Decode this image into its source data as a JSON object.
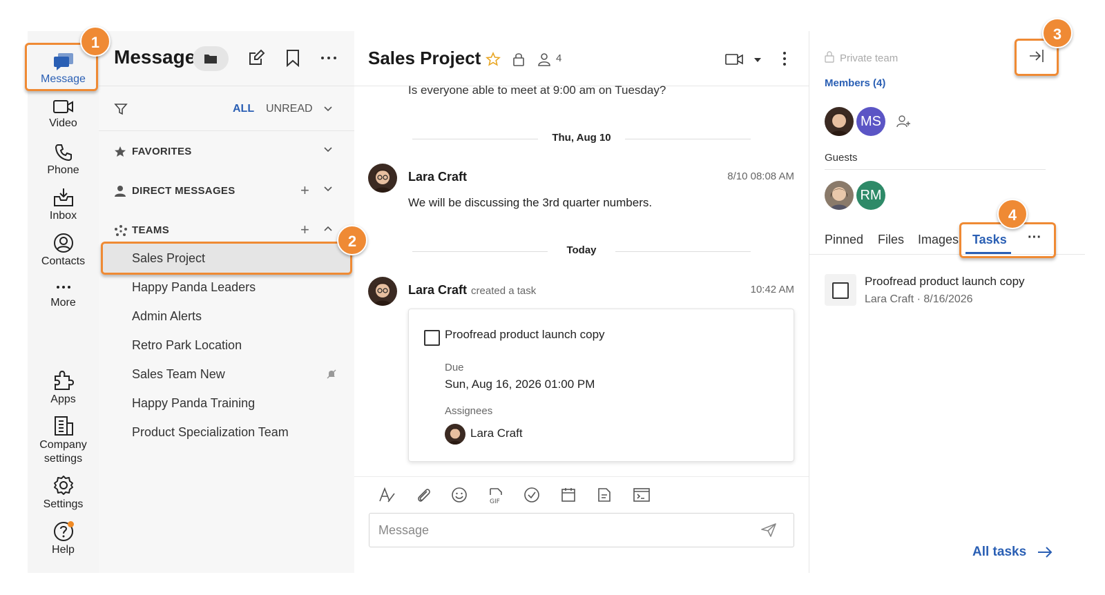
{
  "rail": {
    "items": [
      {
        "label": "Message"
      },
      {
        "label": "Video"
      },
      {
        "label": "Phone"
      },
      {
        "label": "Inbox"
      },
      {
        "label": "Contacts"
      },
      {
        "label": "More"
      },
      {
        "label": "Apps"
      },
      {
        "label": "Company settings"
      },
      {
        "label": "Settings"
      },
      {
        "label": "Help"
      }
    ]
  },
  "list": {
    "title": "Message",
    "filter_all": "ALL",
    "filter_unread": "UNREAD",
    "favorites": "FAVORITES",
    "direct_messages": "DIRECT MESSAGES",
    "teams": "TEAMS",
    "plus": "+",
    "team_items": [
      {
        "label": "Sales Project"
      },
      {
        "label": "Happy Panda Leaders"
      },
      {
        "label": "Admin Alerts"
      },
      {
        "label": "Retro Park Location"
      },
      {
        "label": "Sales Team New"
      },
      {
        "label": "Happy Panda Training"
      },
      {
        "label": "Product Specialization Team"
      }
    ]
  },
  "chat": {
    "title": "Sales Project",
    "member_count": "4",
    "previous_message": "Is everyone able to meet at 9:00 am on Tuesday?",
    "sep1": "Thu, Aug 10",
    "sep2": "Today",
    "msg1": {
      "name": "Lara Craft",
      "time": "8/10 08:08 AM",
      "text": "We will be discussing the 3rd quarter numbers."
    },
    "msg2": {
      "name": "Lara Craft",
      "note": "created a task",
      "time": "10:42 AM"
    },
    "task": {
      "title": "Proofread product launch copy",
      "due_label": "Due",
      "due_value": "Sun, Aug 16, 2026 01:00 PM",
      "assignees_label": "Assignees",
      "assignee": "Lara Craft"
    },
    "input_placeholder": "Message"
  },
  "side": {
    "private": "Private team",
    "members": "Members (4)",
    "member_initials": "MS",
    "guests": "Guests",
    "guest_initials": "RM",
    "tabs": [
      {
        "label": "Pinned"
      },
      {
        "label": "Files"
      },
      {
        "label": "Images"
      },
      {
        "label": "Tasks"
      }
    ],
    "more": "···",
    "task": {
      "title": "Proofread product launch copy",
      "meta": "Lara Craft · 8/16/2026"
    },
    "all_tasks": "All tasks"
  },
  "callouts": [
    "1",
    "2",
    "3",
    "4"
  ],
  "colors": {
    "accent": "#2a5fb4",
    "callout": "#ef8a34",
    "ms": "#5b55c5",
    "rm": "#2e8a68"
  }
}
